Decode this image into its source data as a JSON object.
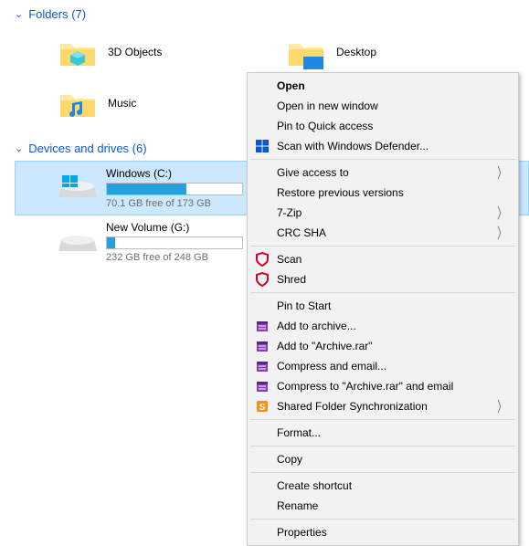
{
  "sections": {
    "folders": {
      "title": "Folders",
      "count": 7
    },
    "drives": {
      "title": "Devices and drives",
      "count": 6
    }
  },
  "folders": [
    {
      "name": "3D Objects"
    },
    {
      "name": "Desktop"
    },
    {
      "name": "Music"
    }
  ],
  "drives": [
    {
      "name": "Windows (C:)",
      "space": "70.1 GB free of 173 GB",
      "fill_pct": 59,
      "selected": true
    },
    {
      "name": "New Volume (G:)",
      "space": "232 GB free of 248 GB",
      "fill_pct": 6,
      "selected": false
    }
  ],
  "context_menu": {
    "open": "Open",
    "open_new_window": "Open in new window",
    "pin_quick_access": "Pin to Quick access",
    "scan_defender": "Scan with Windows Defender...",
    "give_access": "Give access to",
    "restore_prev": "Restore previous versions",
    "seven_zip": "7-Zip",
    "crc_sha": "CRC SHA",
    "scan": "Scan",
    "shred": "Shred",
    "pin_start": "Pin to Start",
    "add_archive": "Add to archive...",
    "add_archive_rar": "Add to \"Archive.rar\"",
    "compress_email": "Compress and email...",
    "compress_rar_email": "Compress to \"Archive.rar\" and email",
    "shared_sync": "Shared Folder Synchronization",
    "format": "Format...",
    "copy": "Copy",
    "create_shortcut": "Create shortcut",
    "rename": "Rename",
    "properties": "Properties"
  }
}
